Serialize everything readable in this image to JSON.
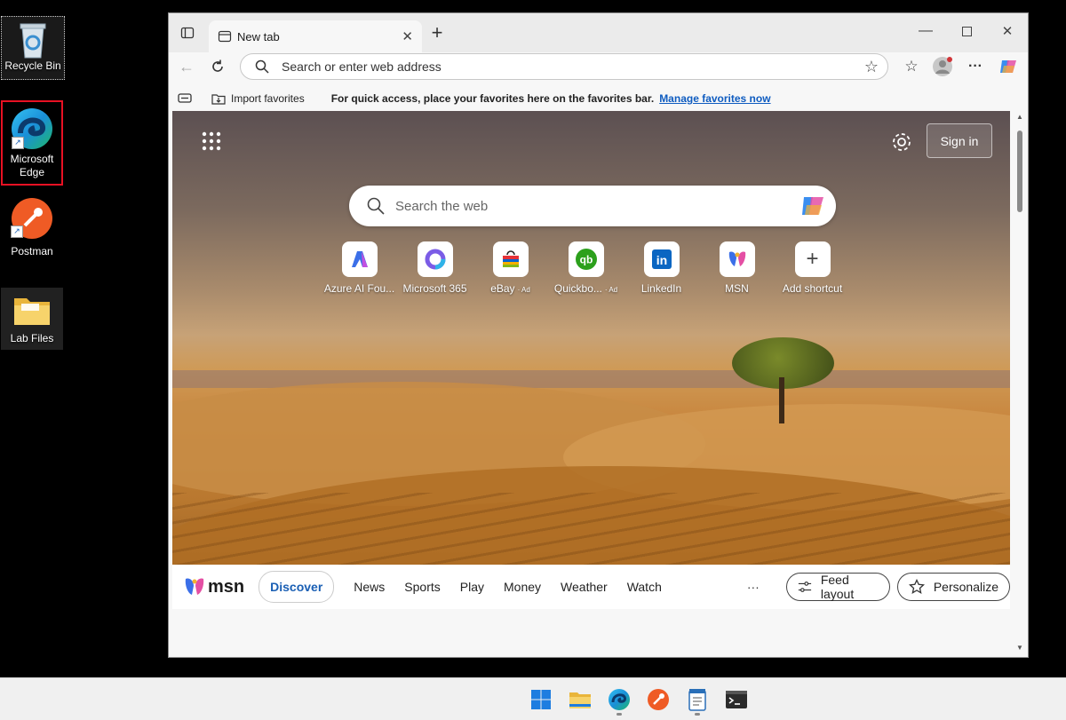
{
  "desktop": {
    "icons": [
      {
        "label": "Recycle Bin",
        "icon": "recycle-bin-icon"
      },
      {
        "label": "Microsoft Edge",
        "icon": "edge-icon"
      },
      {
        "label": "Postman",
        "icon": "postman-icon"
      },
      {
        "label": "Lab Files",
        "icon": "folder-icon"
      }
    ],
    "highlight_color": "#e81123"
  },
  "browser": {
    "tab_title": "New tab",
    "address_placeholder": "Search or enter web address",
    "favorites_bar": {
      "import_label": "Import favorites",
      "hint": "For quick access, place your favorites here on the favorites bar.",
      "manage_link": "Manage favorites now"
    }
  },
  "newtab": {
    "signin_label": "Sign in",
    "search_placeholder": "Search the web",
    "shortcuts": [
      {
        "label": "Azure AI Fou...",
        "ad": "",
        "icon": "azure-ai-icon"
      },
      {
        "label": "Microsoft 365",
        "ad": "",
        "icon": "m365-icon"
      },
      {
        "label": "eBay",
        "ad": "· Ad",
        "icon": "ebay-icon"
      },
      {
        "label": "Quickbo...",
        "ad": "· Ad",
        "icon": "quickbooks-icon"
      },
      {
        "label": "LinkedIn",
        "ad": "",
        "icon": "linkedin-icon"
      },
      {
        "label": "MSN",
        "ad": "",
        "icon": "msn-icon"
      },
      {
        "label": "Add shortcut",
        "ad": "",
        "icon": "plus-icon"
      }
    ],
    "msn": {
      "logo_text": "msn",
      "active_tab": "Discover",
      "tabs": [
        "News",
        "Sports",
        "Play",
        "Money",
        "Weather",
        "Watch"
      ],
      "more": "···",
      "feed_layout_label": "Feed layout",
      "personalize_label": "Personalize"
    }
  },
  "taskbar": {
    "items": [
      "start-icon",
      "file-explorer-icon",
      "edge-icon",
      "postman-icon",
      "notepad-icon",
      "terminal-icon"
    ]
  }
}
